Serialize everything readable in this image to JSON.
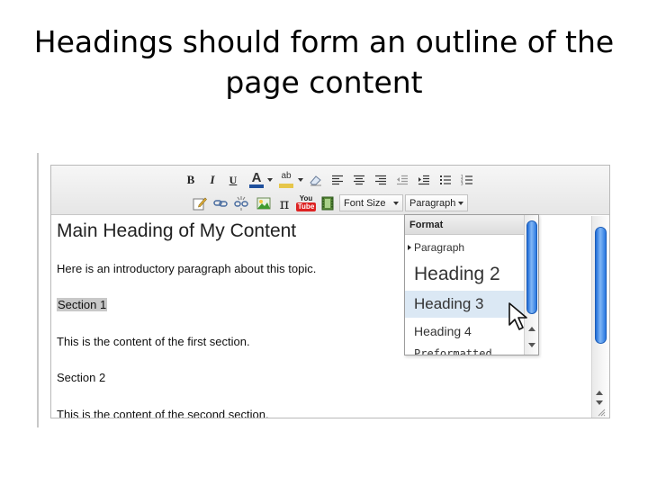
{
  "slide": {
    "title_line1": "Headings should form an outline of the",
    "title_line2": "page content"
  },
  "toolbar": {
    "bold_label": "B",
    "italic_label": "I",
    "underline_label": "U",
    "font_color_label": "A",
    "highlight_label": "ab",
    "pi_label": "π",
    "youtube_label_top": "You",
    "youtube_label_bottom": "Tube",
    "font_size_value": "Font Size",
    "format_value": "Paragraph"
  },
  "content": {
    "heading": "Main Heading of My Content",
    "intro": "Here is an introductory paragraph about this topic.",
    "section1_selected": "Section",
    "section1_rest": " 1",
    "section1_body": "This is the content of the first section.",
    "section2": "Section 2",
    "section2_body": "This is the content of the second section."
  },
  "format_menu": {
    "header": "Format",
    "items": [
      {
        "label": "Paragraph",
        "active": false
      },
      {
        "label": "Heading 2",
        "active": false
      },
      {
        "label": "Heading 3",
        "active": true
      },
      {
        "label": "Heading 4",
        "active": false
      },
      {
        "label": "Preformatted",
        "active": false
      }
    ]
  },
  "colors": {
    "scroll_thumb": "#2a78e0",
    "menu_active": "#dbe8f4",
    "selection": "#c8c8c8"
  }
}
